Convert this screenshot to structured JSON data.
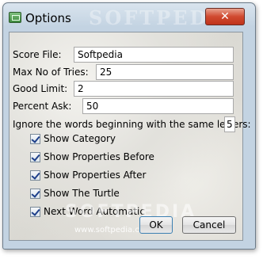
{
  "window": {
    "title": "Options",
    "close_glyph": "✕",
    "icon": "app-icon"
  },
  "form": {
    "score_file": {
      "label": "Score File:",
      "value": "Softpedia"
    },
    "max_tries": {
      "label": "Max No of Tries:",
      "value": "25"
    },
    "good_limit": {
      "label": "Good Limit:",
      "value": "2"
    },
    "percent_ask": {
      "label": "Percent Ask:",
      "value": "50"
    },
    "ignore_prefix": {
      "label": "Ignore the words beginning with the same letters:",
      "value": "5"
    }
  },
  "checkboxes": [
    {
      "label": "Show Category",
      "checked": true
    },
    {
      "label": "Show Properties Before",
      "checked": true
    },
    {
      "label": "Show Properties After",
      "checked": true
    },
    {
      "label": "Show The Turtle",
      "checked": true
    },
    {
      "label": "Next Word Automatic",
      "checked": true
    }
  ],
  "buttons": {
    "ok": "OK",
    "cancel": "Cancel"
  },
  "watermarks": {
    "title": "SOFTPEDIA",
    "center": "SOFTPEDIA",
    "url": "www.softpedia.com"
  }
}
